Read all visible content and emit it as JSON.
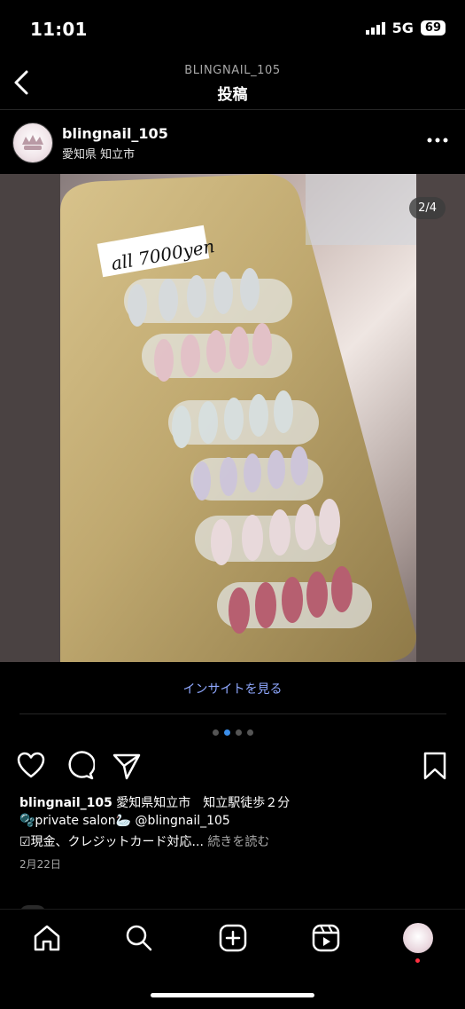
{
  "status_bar": {
    "time": "11:01",
    "network": "5G",
    "battery": "69"
  },
  "header": {
    "username": "BLINGNAIL_105",
    "title": "投稿"
  },
  "post": {
    "username": "blingnail_105",
    "location": "愛知県 知立市",
    "page_counter": "2/4",
    "photo_text": "all 7000yen",
    "insight_link": "インサイトを見る",
    "caption_user": "blingnail_105",
    "caption_line1": " 愛知県知立市　知立駅徒歩２分",
    "caption_line2": "🫧private salon🦢 @blingnail_105",
    "caption_line3": "☑現金、クレジットカード対応...",
    "more_label": " 続きを読む",
    "date": "2月22日",
    "carousel_dots": 4,
    "carousel_active": 2
  },
  "icons": {
    "back": "chevron-left-icon",
    "more": "more-horizontal-icon",
    "like": "heart-icon",
    "comment": "comment-icon",
    "share": "send-icon",
    "save": "bookmark-icon",
    "home": "home-icon",
    "search": "search-icon",
    "create": "plus-square-icon",
    "reels": "reels-icon"
  },
  "colors": {
    "background": "#000000",
    "link": "#8fa8ff",
    "active_dot": "#3b8eea",
    "notification": "#ff3040"
  }
}
